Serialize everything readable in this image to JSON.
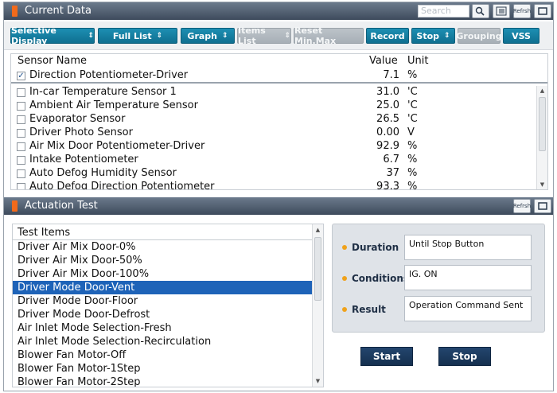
{
  "current_data": {
    "title": "Current Data",
    "search_placeholder": "Search",
    "refresh_label": "Refrsh",
    "toolbar": {
      "selective_display": "Selective Display",
      "full_list": "Full List",
      "graph": "Graph",
      "items_list": "Items List",
      "reset_minmax": "Reset Min.Max",
      "record": "Record",
      "stop": "Stop",
      "grouping": "Grouping",
      "vss": "VSS"
    },
    "columns": {
      "name": "Sensor Name",
      "value": "Value",
      "unit": "Unit"
    },
    "fixed_row": {
      "name": "Direction Potentiometer-Driver",
      "value": "7.1",
      "unit": "%",
      "checked": true
    },
    "rows": [
      {
        "name": "In-car Temperature Sensor 1",
        "value": "31.0",
        "unit": "'C"
      },
      {
        "name": "Ambient Air Temperature Sensor",
        "value": "25.0",
        "unit": "'C"
      },
      {
        "name": "Evaporator Sensor",
        "value": "26.5",
        "unit": "'C"
      },
      {
        "name": "Driver Photo Sensor",
        "value": "0.00",
        "unit": "V"
      },
      {
        "name": "Air Mix Door Potentiometer-Driver",
        "value": "92.9",
        "unit": "%"
      },
      {
        "name": "Intake Potentiometer",
        "value": "6.7",
        "unit": "%"
      },
      {
        "name": "Auto Defog Humidity Sensor",
        "value": "37",
        "unit": "%"
      },
      {
        "name": "Auto Defog Direction Potentiometer",
        "value": "93.3",
        "unit": "%"
      }
    ]
  },
  "actuation": {
    "title": "Actuation Test",
    "refresh_label": "Refrsh",
    "list_header": "Test Items",
    "items": [
      "Driver Air Mix Door-0%",
      "Driver Air Mix Door-50%",
      "Driver Air Mix Door-100%",
      "Driver Mode Door-Vent",
      "Driver Mode Door-Floor",
      "Driver Mode Door-Defrost",
      "Air Inlet Mode Selection-Fresh",
      "Air Inlet Mode Selection-Recirculation",
      "Blower Fan Motor-Off",
      "Blower Fan Motor-1Step",
      "Blower Fan Motor-2Step"
    ],
    "selected_index": 3,
    "fields": {
      "duration_label": "Duration",
      "duration_value": "Until Stop Button",
      "conditions_label": "Conditions",
      "conditions_value": "IG. ON",
      "result_label": "Result",
      "result_value": "Operation Command Sent"
    },
    "start_label": "Start",
    "stop_label": "Stop"
  },
  "colors": {
    "titlebar": "#4a596b",
    "toolbar_button": "#1480a4",
    "selection": "#1e63b8",
    "action_button": "#1c3a5e",
    "bullet": "#f0a21b"
  }
}
